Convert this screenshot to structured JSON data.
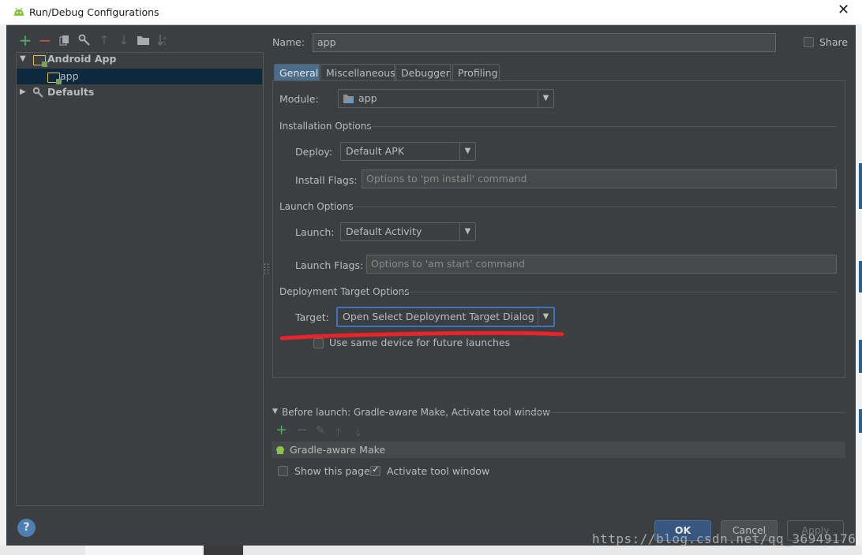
{
  "window": {
    "title": "Run/Debug Configurations"
  },
  "toolbar": {
    "add": "+",
    "remove": "−"
  },
  "tree": [
    {
      "label": "Android App"
    },
    {
      "label": "app"
    },
    {
      "label": "Defaults"
    }
  ],
  "name_label": "Name:",
  "name_value": "app",
  "share_label": "Share",
  "tabs": [
    "General",
    "Miscellaneous",
    "Debugger",
    "Profiling"
  ],
  "module": {
    "label": "Module:",
    "value": "app"
  },
  "installation": {
    "title": "Installation Options",
    "deploy_label": "Deploy:",
    "deploy_value": "Default APK",
    "flags_label": "Install Flags:",
    "flags_placeholder": "Options to 'pm install' command"
  },
  "launch": {
    "title": "Launch Options",
    "launch_label": "Launch:",
    "launch_value": "Default Activity",
    "flags_label": "Launch Flags:",
    "flags_placeholder": "Options to 'am start' command"
  },
  "deployment": {
    "title": "Deployment Target Options",
    "target_label": "Target:",
    "target_value": "Open Select Deployment Target Dialog",
    "same_device_label": "Use same device for future launches"
  },
  "before_launch": {
    "title": "Before launch: Gradle-aware Make, Activate tool window",
    "task": "Gradle-aware Make",
    "show_page_label": "Show this page",
    "activate_label": "Activate tool window",
    "show_page_checked": false,
    "activate_checked": true
  },
  "buttons": {
    "ok": "OK",
    "cancel": "Cancel",
    "apply": "Apply",
    "help": "?"
  },
  "watermark": "https://blog.csdn.net/qq_36949176",
  "colors": {
    "annotation_underline": "#e8232a",
    "focus_border": "#3d76b8",
    "selected_row": "#0d293e"
  }
}
